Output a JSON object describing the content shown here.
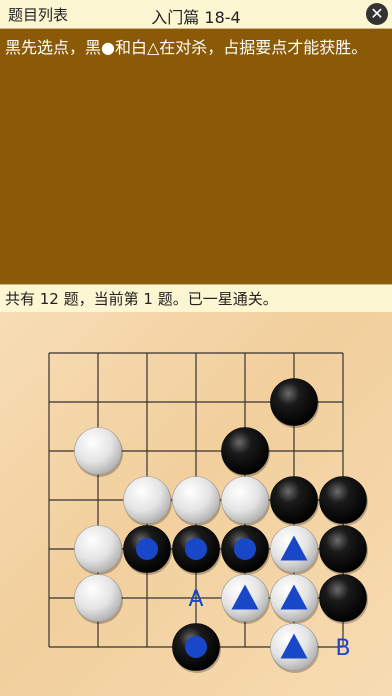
{
  "header": {
    "back_label": "题目列表",
    "title": "入门篇 18-4",
    "close_icon": "close-icon"
  },
  "problem": {
    "description": "黑先选点，黑●和白△在对杀，占据要点才能获胜。"
  },
  "status": {
    "text": "共有 12 题，当前第 1 题。已一星通关。"
  },
  "board": {
    "columns": 7,
    "rows": 7,
    "black_color": "#000000",
    "white_color": "#e4e4e4",
    "marker_color": "#1848c8",
    "stones": [
      {
        "col": 5,
        "row": 1,
        "color": "black"
      },
      {
        "col": 1,
        "row": 2,
        "color": "white"
      },
      {
        "col": 4,
        "row": 2,
        "color": "black"
      },
      {
        "col": 2,
        "row": 3,
        "color": "white"
      },
      {
        "col": 3,
        "row": 3,
        "color": "white"
      },
      {
        "col": 4,
        "row": 3,
        "color": "white"
      },
      {
        "col": 5,
        "row": 3,
        "color": "black"
      },
      {
        "col": 6,
        "row": 3,
        "color": "black"
      },
      {
        "col": 1,
        "row": 4,
        "color": "white"
      },
      {
        "col": 2,
        "row": 4,
        "color": "black",
        "marker": "circle"
      },
      {
        "col": 3,
        "row": 4,
        "color": "black",
        "marker": "circle"
      },
      {
        "col": 4,
        "row": 4,
        "color": "black",
        "marker": "circle"
      },
      {
        "col": 5,
        "row": 4,
        "color": "white",
        "marker": "triangle"
      },
      {
        "col": 6,
        "row": 4,
        "color": "black"
      },
      {
        "col": 1,
        "row": 5,
        "color": "white"
      },
      {
        "col": 4,
        "row": 5,
        "color": "white",
        "marker": "triangle"
      },
      {
        "col": 5,
        "row": 5,
        "color": "white",
        "marker": "triangle"
      },
      {
        "col": 6,
        "row": 5,
        "color": "black"
      },
      {
        "col": 3,
        "row": 6,
        "color": "black",
        "marker": "circle"
      },
      {
        "col": 5,
        "row": 6,
        "color": "white",
        "marker": "triangle"
      }
    ],
    "labels": [
      {
        "col": 3,
        "row": 5,
        "text": "A"
      },
      {
        "col": 6,
        "row": 6,
        "text": "B"
      }
    ]
  }
}
